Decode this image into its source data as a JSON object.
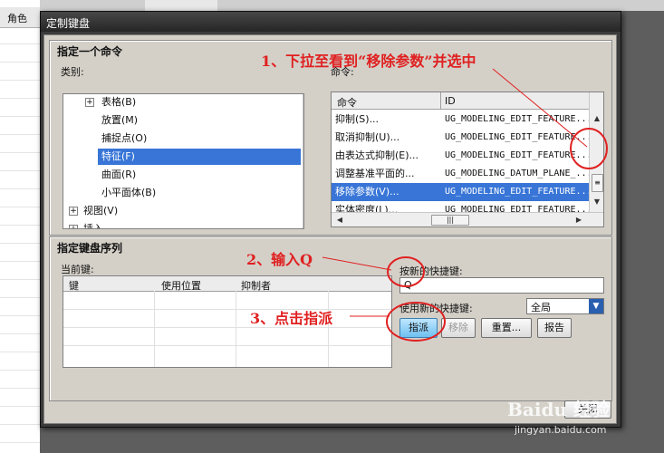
{
  "background": {
    "header_label": "角色"
  },
  "dialog": {
    "title": "定制键盘",
    "choose_command": {
      "title": "指定一个命令",
      "category_label": "类别:",
      "command_label": "命令:",
      "tree_items": [
        {
          "label": "表格(B)",
          "expander": "+"
        },
        {
          "label": "放置(M)"
        },
        {
          "label": "捕捉点(O)"
        },
        {
          "label": "特征(F)",
          "selected": true
        },
        {
          "label": "曲面(R)"
        },
        {
          "label": "小平面体(B)"
        },
        {
          "label": "视图(V)",
          "expander": "+"
        },
        {
          "label": "插入",
          "expander": "+"
        }
      ],
      "command_columns": [
        "命令",
        "ID"
      ],
      "commands": [
        {
          "name": "抑制(S)...",
          "id": "UG_MODELING_EDIT_FEATURE..."
        },
        {
          "name": "取消抑制(U)...",
          "id": "UG_MODELING_EDIT_FEATURE..."
        },
        {
          "name": "由表达式抑制(E)...",
          "id": "UG_MODELING_EDIT_FEATURE..."
        },
        {
          "name": "调整基准平面的...",
          "id": "UG_MODELING_DATUM_PLANE_..."
        },
        {
          "name": "移除参数(V)...",
          "id": "UG_MODELING_EDIT_FEATURE...",
          "selected": true
        },
        {
          "name": "实体密度(L)...",
          "id": "UG_MODELING_EDIT_FEATURE..."
        }
      ]
    },
    "key_sequence": {
      "title": "指定键盘序列",
      "current_keys_label": "当前键:",
      "columns": [
        "键",
        "使用位置",
        "抑制者"
      ],
      "new_shortcut_label": "按新的快捷键:",
      "new_shortcut_value": "Q",
      "use_shortcut_label": "使用新的快捷键:",
      "scope_value": "全局",
      "buttons": {
        "assign": "指派",
        "remove": "移除",
        "reset": "重置...",
        "report": "报告"
      }
    },
    "close_button": "关闭"
  },
  "annotations": [
    "1、下拉至看到“移除参数”并选中",
    "2、输入Q",
    "3、点击指派"
  ],
  "watermark": {
    "brand": "Baidu 经验",
    "url": "jingyan.baidu.com"
  },
  "colors": {
    "selection": "#3875d7",
    "annotation": "#e02020",
    "assign_button": "#6fc0f0"
  }
}
